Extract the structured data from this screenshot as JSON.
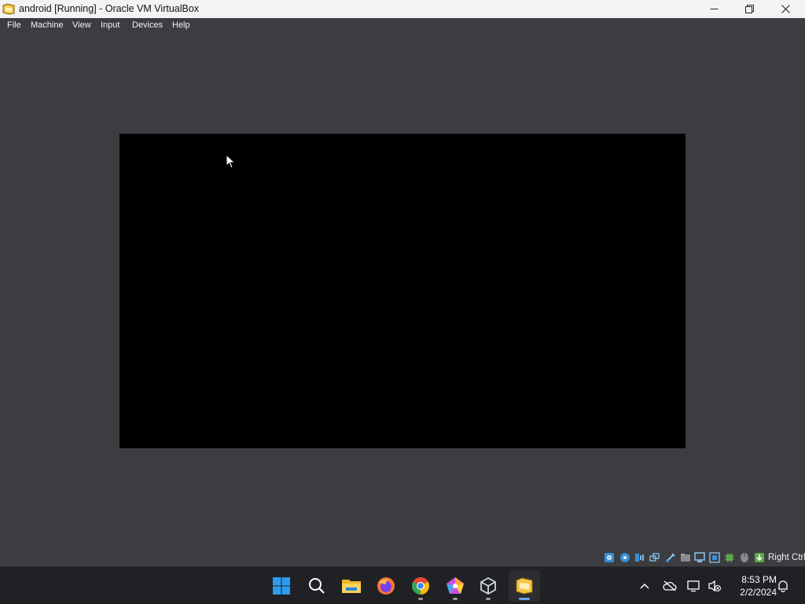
{
  "window": {
    "title": "android [Running] - Oracle VM VirtualBox",
    "icon": "virtualbox-vm-icon",
    "controls": [
      "minimize-icon",
      "restore-icon",
      "close-icon"
    ]
  },
  "menu": {
    "items": [
      {
        "label": "File"
      },
      {
        "label": "Machine"
      },
      {
        "label": "View"
      },
      {
        "label": "Input"
      },
      {
        "label": "Devices"
      },
      {
        "label": "Help"
      }
    ]
  },
  "vm_screen": {
    "background": "#000000"
  },
  "statusbar": {
    "icons": [
      "hard-disk-icon",
      "optical-drive-icon",
      "audio-icon",
      "network-icon",
      "usb-icon",
      "shared-folders-icon",
      "display-icon",
      "recording-icon",
      "cpu-icon",
      "mouse-integration-icon",
      "keyboard-icon"
    ],
    "host_key": "Right Ctrl"
  },
  "taskbar": {
    "apps": [
      "windows-start-icon",
      "search-icon",
      "file-explorer-icon",
      "firefox-icon",
      "chrome-icon",
      "pentagon-app-icon",
      "virtualbox-icon",
      "virtualbox-vm-icon"
    ],
    "tray": [
      "chevron-up-icon",
      "cloud-offline-icon",
      "network-icon",
      "volume-muted-icon",
      "notification-bell-icon"
    ],
    "time": "8:53 PM",
    "date": "2/2/2024"
  },
  "colors": {
    "window_bg": "#3c3d40",
    "titlebar_bg": "#f3f3f3",
    "taskbar_bg": "#202124",
    "accent": "#5ea6ef"
  }
}
